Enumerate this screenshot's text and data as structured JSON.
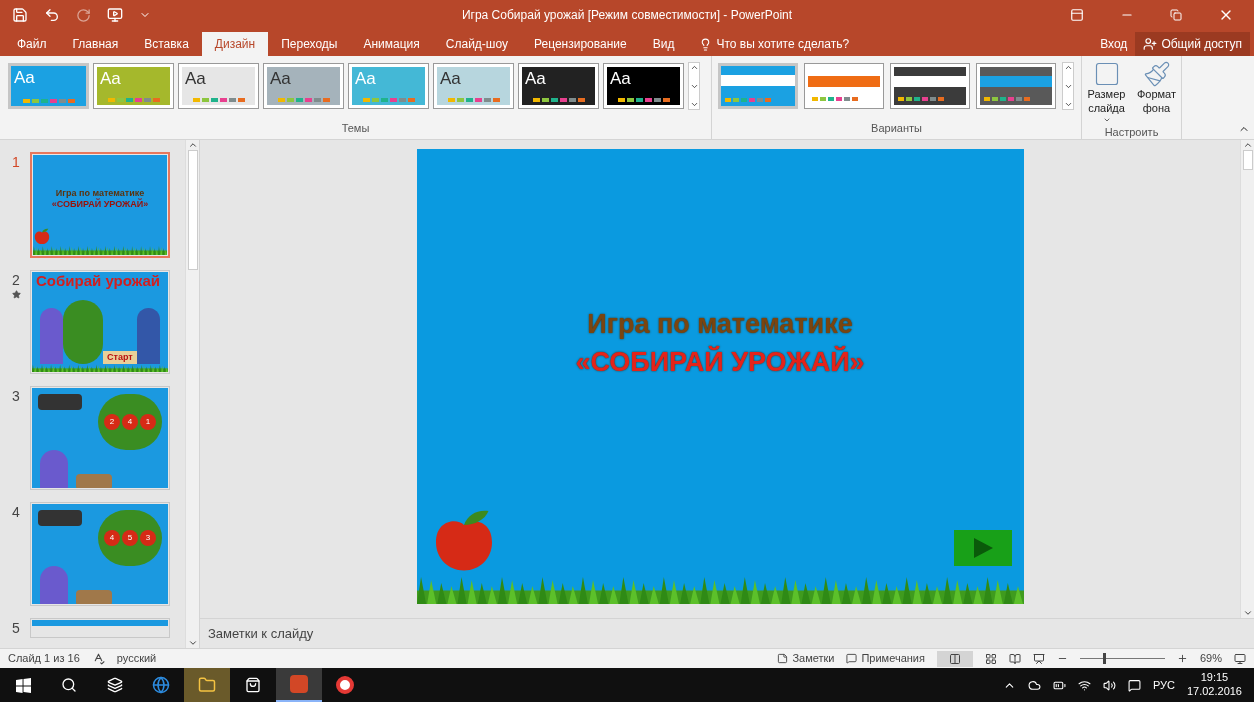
{
  "window": {
    "title": "Игра Собирай урожай [Режим совместимости] - PowerPoint"
  },
  "tabs": [
    {
      "label": "Файл",
      "selected": false
    },
    {
      "label": "Главная",
      "selected": false
    },
    {
      "label": "Вставка",
      "selected": false
    },
    {
      "label": "Дизайн",
      "selected": true
    },
    {
      "label": "Переходы",
      "selected": false
    },
    {
      "label": "Анимация",
      "selected": false
    },
    {
      "label": "Слайд-шоу",
      "selected": false
    },
    {
      "label": "Рецензирование",
      "selected": false
    },
    {
      "label": "Вид",
      "selected": false
    }
  ],
  "tell_me": {
    "placeholder": "Что вы хотите сделать?"
  },
  "sign_in": "Вход",
  "share": "Общий доступ",
  "themes": {
    "label": "Темы",
    "items": [
      {
        "label": "Aa",
        "color": "#1ba1e2",
        "selected": true
      },
      {
        "label": "Aa",
        "color": "#a5b82c",
        "selected": false
      },
      {
        "label": "Aa",
        "color": "#e6e6e6",
        "selected": false
      },
      {
        "label": "Aa",
        "color": "#a5b3bb",
        "selected": false
      },
      {
        "label": "Aa",
        "color": "#44b8d6",
        "selected": false
      },
      {
        "label": "Aa",
        "color": "#b7d6de",
        "selected": false
      },
      {
        "label": "Aa",
        "color": "#222222",
        "selected": false
      },
      {
        "label": "Aa",
        "color": "#000000",
        "selected": false
      }
    ]
  },
  "variants": {
    "label": "Варианты",
    "items": [
      {
        "color": "#1ba1e2",
        "selected": true
      },
      {
        "color": "#ffffff",
        "selected": false
      },
      {
        "color": "#3b3b3b",
        "selected": false
      },
      {
        "color": "#595959",
        "selected": false
      }
    ]
  },
  "customize": {
    "label": "Настроить",
    "buttons": [
      {
        "label": "Размер слайда",
        "dropdown": true
      },
      {
        "label": "Формат фона",
        "dropdown": false
      }
    ]
  },
  "slides": [
    {
      "number": "1",
      "selected": true,
      "animated": false,
      "kind": "title",
      "texts": [
        "Игра по математике",
        "«СОБИРАЙ УРОЖАЙ»"
      ]
    },
    {
      "number": "2",
      "selected": false,
      "animated": true,
      "kind": "start",
      "texts": [
        "Собирай урожай",
        "Старт"
      ]
    },
    {
      "number": "3",
      "selected": false,
      "animated": false,
      "kind": "task",
      "texts": [
        "2",
        "4",
        "1"
      ]
    },
    {
      "number": "4",
      "selected": false,
      "animated": false,
      "kind": "task",
      "texts": [
        "4",
        "5",
        "3"
      ]
    },
    {
      "number": "5",
      "selected": false,
      "animated": false,
      "kind": "partial"
    }
  ],
  "slide": {
    "lines": [
      "Игра по математике",
      "«СОБИРАЙ УРОЖАЙ»"
    ]
  },
  "notes": {
    "placeholder": "Заметки к слайду"
  },
  "status": {
    "slide": "Слайд 1 из 16",
    "language": "русский",
    "notes": "Заметки",
    "comments": "Примечания",
    "zoom": {
      "level": 0.27
    },
    "zoom_reading": "69%"
  },
  "taskbar": {
    "language": "РУС",
    "time": "19:15",
    "date": "17.02.2016"
  }
}
